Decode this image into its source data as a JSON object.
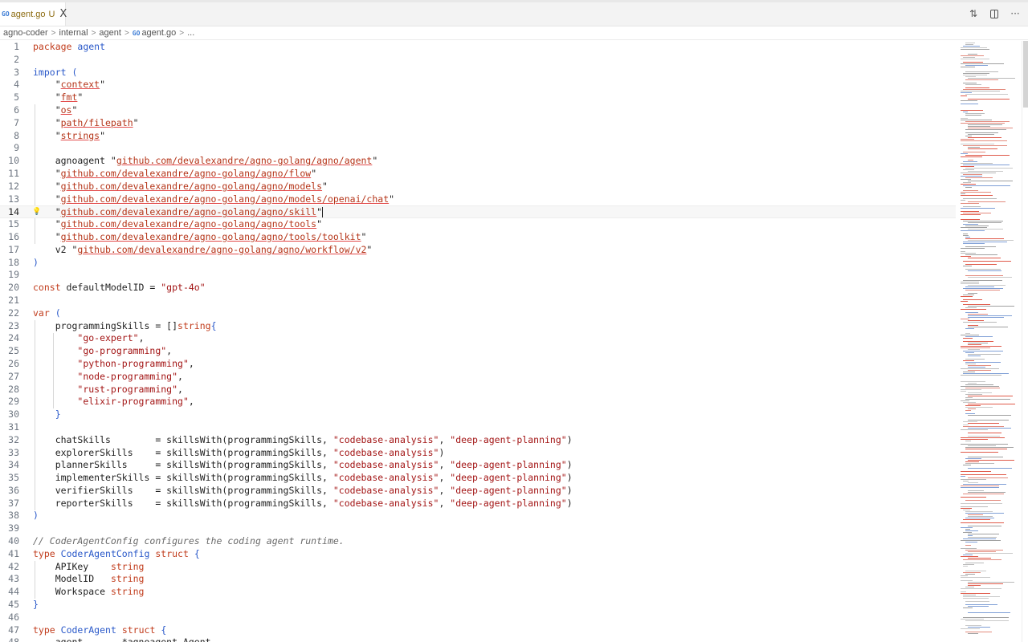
{
  "tab": {
    "icon": "go-file-icon",
    "icon_glyph": "GO",
    "name": "agent.go",
    "status": "U",
    "close_glyph": "X"
  },
  "actions": [
    {
      "name": "open-changes-icon",
      "glyph": "⇅"
    },
    {
      "name": "split-editor-icon",
      "glyph": ""
    },
    {
      "name": "more-actions-icon",
      "glyph": "···"
    }
  ],
  "breadcrumb": {
    "items": [
      "agno-coder",
      "internal",
      "agent",
      "agent.go",
      "..."
    ],
    "separator": ">",
    "go_glyph": "GO"
  },
  "editor": {
    "current_line": 14,
    "lines": [
      {
        "n": "1",
        "tokens": [
          {
            "t": "package",
            "c": "kw"
          },
          {
            "t": " "
          },
          {
            "t": "agent",
            "c": "id"
          }
        ]
      },
      {
        "n": "2",
        "tokens": []
      },
      {
        "n": "3",
        "tokens": [
          {
            "t": "import",
            "c": "id"
          },
          {
            "t": " "
          },
          {
            "t": "(",
            "c": "br"
          }
        ]
      },
      {
        "n": "4",
        "tokens": [
          {
            "t": "    \""
          },
          {
            "t": "context",
            "c": "strl"
          },
          {
            "t": "\""
          }
        ]
      },
      {
        "n": "5",
        "tokens": [
          {
            "t": "    \""
          },
          {
            "t": "fmt",
            "c": "strl"
          },
          {
            "t": "\""
          }
        ]
      },
      {
        "n": "6",
        "tokens": [
          {
            "t": "    \""
          },
          {
            "t": "os",
            "c": "strl"
          },
          {
            "t": "\""
          }
        ]
      },
      {
        "n": "7",
        "tokens": [
          {
            "t": "    \""
          },
          {
            "t": "path/filepath",
            "c": "strl"
          },
          {
            "t": "\""
          }
        ]
      },
      {
        "n": "8",
        "tokens": [
          {
            "t": "    \""
          },
          {
            "t": "strings",
            "c": "strl"
          },
          {
            "t": "\""
          }
        ]
      },
      {
        "n": "9",
        "tokens": []
      },
      {
        "n": "10",
        "tokens": [
          {
            "t": "    agnoagent \""
          },
          {
            "t": "github.com/devalexandre/agno-golang/agno/agent",
            "c": "strl"
          },
          {
            "t": "\""
          }
        ]
      },
      {
        "n": "11",
        "tokens": [
          {
            "t": "    \""
          },
          {
            "t": "github.com/devalexandre/agno-golang/agno/flow",
            "c": "strl"
          },
          {
            "t": "\""
          }
        ]
      },
      {
        "n": "12",
        "tokens": [
          {
            "t": "    \""
          },
          {
            "t": "github.com/devalexandre/agno-golang/agno/models",
            "c": "strl"
          },
          {
            "t": "\""
          }
        ]
      },
      {
        "n": "13",
        "tokens": [
          {
            "t": "    \""
          },
          {
            "t": "github.com/devalexandre/agno-golang/agno/models/openai/chat",
            "c": "strl"
          },
          {
            "t": "\""
          }
        ]
      },
      {
        "n": "14",
        "tokens": [
          {
            "t": "    \""
          },
          {
            "t": "github.com/devalexandre/agno-golang/agno/skill",
            "c": "strl"
          },
          {
            "t": "\""
          }
        ]
      },
      {
        "n": "15",
        "tokens": [
          {
            "t": "    \""
          },
          {
            "t": "github.com/devalexandre/agno-golang/agno/tools",
            "c": "strl"
          },
          {
            "t": "\""
          }
        ]
      },
      {
        "n": "16",
        "tokens": [
          {
            "t": "    \""
          },
          {
            "t": "github.com/devalexandre/agno-golang/agno/tools/toolkit",
            "c": "strl"
          },
          {
            "t": "\""
          }
        ]
      },
      {
        "n": "17",
        "tokens": [
          {
            "t": "    v2 \""
          },
          {
            "t": "github.com/devalexandre/agno-golang/agno/workflow/v2",
            "c": "strl"
          },
          {
            "t": "\""
          }
        ]
      },
      {
        "n": "18",
        "tokens": [
          {
            "t": ")",
            "c": "br"
          }
        ]
      },
      {
        "n": "19",
        "tokens": []
      },
      {
        "n": "20",
        "tokens": [
          {
            "t": "const",
            "c": "kw"
          },
          {
            "t": " defaultModelID = "
          },
          {
            "t": "\"gpt-4o\"",
            "c": "str"
          }
        ]
      },
      {
        "n": "21",
        "tokens": []
      },
      {
        "n": "22",
        "tokens": [
          {
            "t": "var",
            "c": "kw"
          },
          {
            "t": " "
          },
          {
            "t": "(",
            "c": "br"
          }
        ]
      },
      {
        "n": "23",
        "tokens": [
          {
            "t": "    programmingSkills = []"
          },
          {
            "t": "string",
            "c": "kw"
          },
          {
            "t": "{",
            "c": "br"
          }
        ]
      },
      {
        "n": "24",
        "tokens": [
          {
            "t": "        "
          },
          {
            "t": "\"go-expert\"",
            "c": "str"
          },
          {
            "t": ","
          }
        ]
      },
      {
        "n": "25",
        "tokens": [
          {
            "t": "        "
          },
          {
            "t": "\"go-programming\"",
            "c": "str"
          },
          {
            "t": ","
          }
        ]
      },
      {
        "n": "26",
        "tokens": [
          {
            "t": "        "
          },
          {
            "t": "\"python-programming\"",
            "c": "str"
          },
          {
            "t": ","
          }
        ]
      },
      {
        "n": "27",
        "tokens": [
          {
            "t": "        "
          },
          {
            "t": "\"node-programming\"",
            "c": "str"
          },
          {
            "t": ","
          }
        ]
      },
      {
        "n": "28",
        "tokens": [
          {
            "t": "        "
          },
          {
            "t": "\"rust-programming\"",
            "c": "str"
          },
          {
            "t": ","
          }
        ]
      },
      {
        "n": "29",
        "tokens": [
          {
            "t": "        "
          },
          {
            "t": "\"elixir-programming\"",
            "c": "str"
          },
          {
            "t": ","
          }
        ]
      },
      {
        "n": "30",
        "tokens": [
          {
            "t": "    "
          },
          {
            "t": "}",
            "c": "br"
          }
        ]
      },
      {
        "n": "31",
        "tokens": []
      },
      {
        "n": "32",
        "tokens": [
          {
            "t": "    chatSkills        = skillsWith(programmingSkills, "
          },
          {
            "t": "\"codebase-analysis\"",
            "c": "str"
          },
          {
            "t": ", "
          },
          {
            "t": "\"deep-agent-planning\"",
            "c": "str"
          },
          {
            "t": ")"
          }
        ]
      },
      {
        "n": "33",
        "tokens": [
          {
            "t": "    explorerSkills    = skillsWith(programmingSkills, "
          },
          {
            "t": "\"codebase-analysis\"",
            "c": "str"
          },
          {
            "t": ")"
          }
        ]
      },
      {
        "n": "34",
        "tokens": [
          {
            "t": "    plannerSkills     = skillsWith(programmingSkills, "
          },
          {
            "t": "\"codebase-analysis\"",
            "c": "str"
          },
          {
            "t": ", "
          },
          {
            "t": "\"deep-agent-planning\"",
            "c": "str"
          },
          {
            "t": ")"
          }
        ]
      },
      {
        "n": "35",
        "tokens": [
          {
            "t": "    implementerSkills = skillsWith(programmingSkills, "
          },
          {
            "t": "\"codebase-analysis\"",
            "c": "str"
          },
          {
            "t": ", "
          },
          {
            "t": "\"deep-agent-planning\"",
            "c": "str"
          },
          {
            "t": ")"
          }
        ]
      },
      {
        "n": "36",
        "tokens": [
          {
            "t": "    verifierSkills    = skillsWith(programmingSkills, "
          },
          {
            "t": "\"codebase-analysis\"",
            "c": "str"
          },
          {
            "t": ", "
          },
          {
            "t": "\"deep-agent-planning\"",
            "c": "str"
          },
          {
            "t": ")"
          }
        ]
      },
      {
        "n": "37",
        "tokens": [
          {
            "t": "    reporterSkills    = skillsWith(programmingSkills, "
          },
          {
            "t": "\"codebase-analysis\"",
            "c": "str"
          },
          {
            "t": ", "
          },
          {
            "t": "\"deep-agent-planning\"",
            "c": "str"
          },
          {
            "t": ")"
          }
        ]
      },
      {
        "n": "38",
        "tokens": [
          {
            "t": ")",
            "c": "br"
          }
        ]
      },
      {
        "n": "39",
        "tokens": []
      },
      {
        "n": "40",
        "tokens": [
          {
            "t": "// CoderAgentConfig configures the coding agent runtime.",
            "c": "cm"
          }
        ]
      },
      {
        "n": "41",
        "tokens": [
          {
            "t": "type",
            "c": "kw"
          },
          {
            "t": " "
          },
          {
            "t": "CoderAgentConfig",
            "c": "id"
          },
          {
            "t": " "
          },
          {
            "t": "struct",
            "c": "kw"
          },
          {
            "t": " "
          },
          {
            "t": "{",
            "c": "br"
          }
        ]
      },
      {
        "n": "42",
        "tokens": [
          {
            "t": "    APIKey    "
          },
          {
            "t": "string",
            "c": "kw"
          }
        ]
      },
      {
        "n": "43",
        "tokens": [
          {
            "t": "    ModelID   "
          },
          {
            "t": "string",
            "c": "kw"
          }
        ]
      },
      {
        "n": "44",
        "tokens": [
          {
            "t": "    Workspace "
          },
          {
            "t": "string",
            "c": "kw"
          }
        ]
      },
      {
        "n": "45",
        "tokens": [
          {
            "t": "}",
            "c": "br"
          }
        ]
      },
      {
        "n": "46",
        "tokens": []
      },
      {
        "n": "47",
        "tokens": [
          {
            "t": "type",
            "c": "kw"
          },
          {
            "t": " "
          },
          {
            "t": "CoderAgent",
            "c": "id"
          },
          {
            "t": " "
          },
          {
            "t": "struct",
            "c": "kw"
          },
          {
            "t": " "
          },
          {
            "t": "{",
            "c": "br"
          }
        ]
      },
      {
        "n": "48",
        "tokens": [
          {
            "t": "    agent       *agnoagent.Agent"
          }
        ]
      }
    ]
  },
  "colors": {
    "keyword": "#c13c1c",
    "identifier": "#2958c9",
    "string": "#a31515",
    "comment": "#6a6a6a",
    "line_number": "#6e7681"
  }
}
